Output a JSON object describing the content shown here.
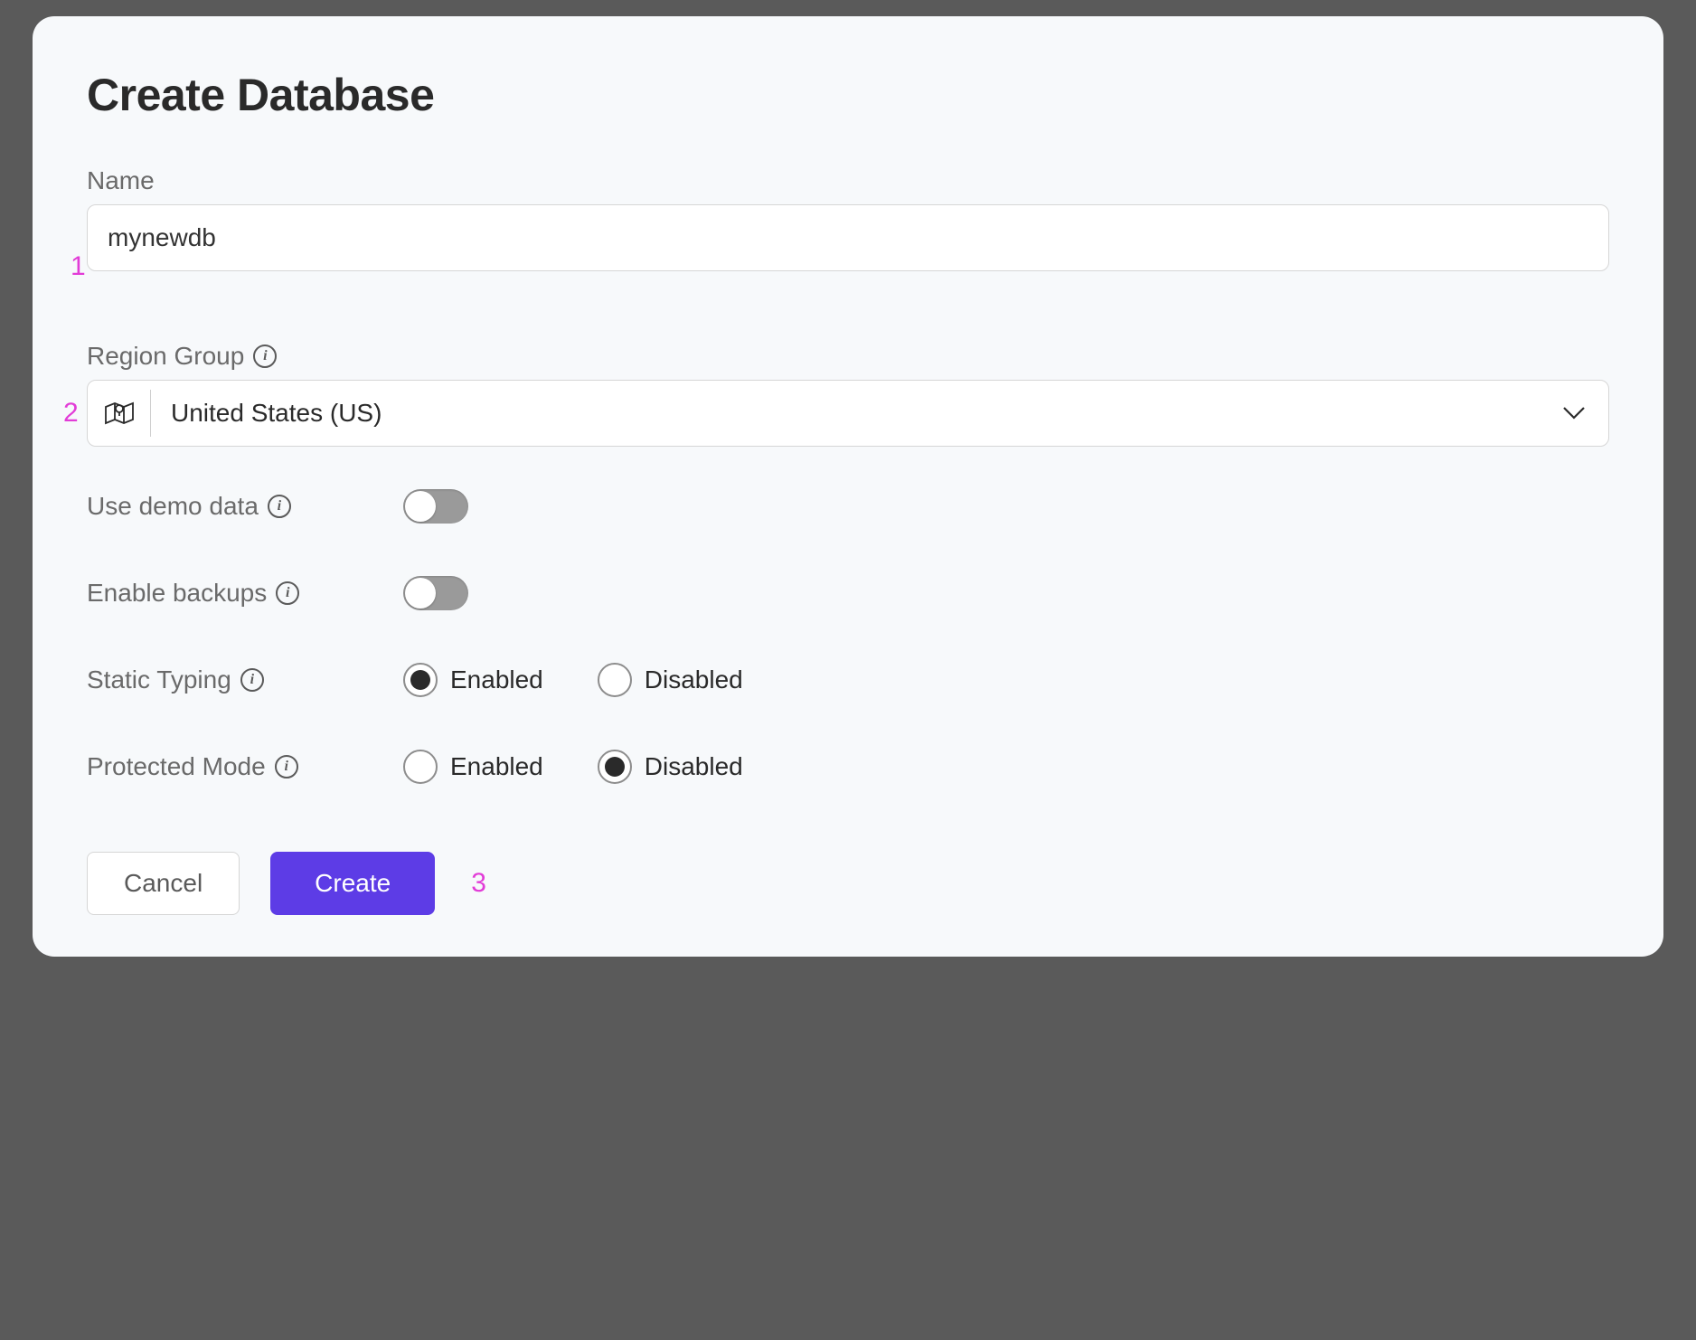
{
  "dialog": {
    "title": "Create Database"
  },
  "name": {
    "label": "Name",
    "value": "mynewdb"
  },
  "region": {
    "label": "Region Group",
    "selected": "United States (US)"
  },
  "demo_data": {
    "label": "Use demo data",
    "enabled": false
  },
  "backups": {
    "label": "Enable backups",
    "enabled": false
  },
  "static_typing": {
    "label": "Static Typing",
    "options": {
      "enabled": "Enabled",
      "disabled": "Disabled"
    },
    "value": "enabled"
  },
  "protected_mode": {
    "label": "Protected Mode",
    "options": {
      "enabled": "Enabled",
      "disabled": "Disabled"
    },
    "value": "disabled"
  },
  "actions": {
    "cancel": "Cancel",
    "create": "Create"
  },
  "annotations": {
    "a1": "1",
    "a2": "2",
    "a3": "3"
  }
}
